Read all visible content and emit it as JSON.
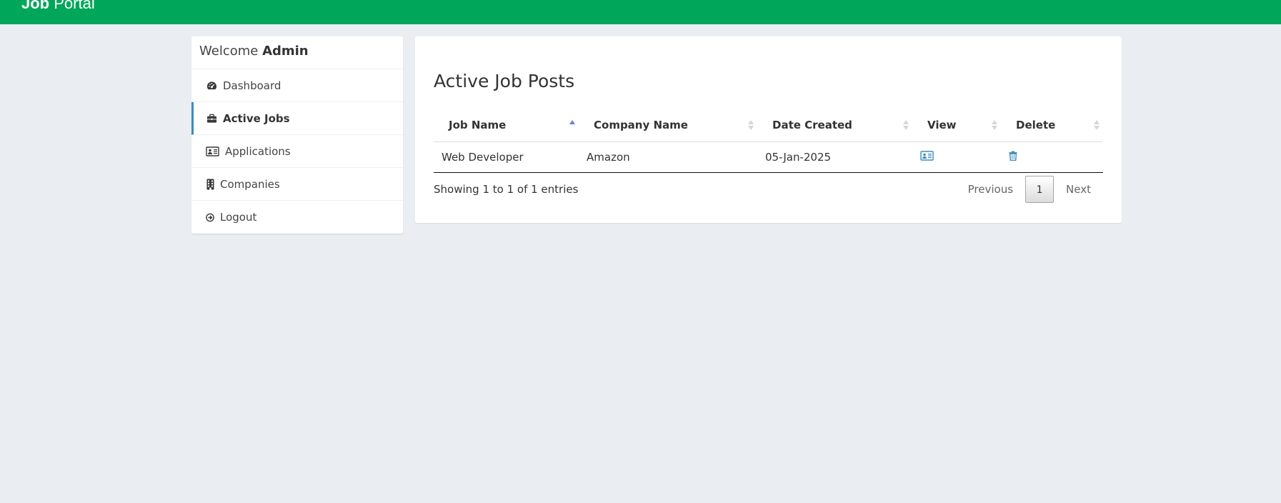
{
  "header": {
    "brand_bold": "Job",
    "brand_rest": " Portal",
    "bg_color": "#00a65a"
  },
  "sidebar": {
    "welcome_prefix": "Welcome ",
    "welcome_user": "Admin",
    "items": [
      {
        "label": "Dashboard",
        "icon": "dashboard-icon",
        "active": false
      },
      {
        "label": "Active Jobs",
        "icon": "briefcase-icon",
        "active": true
      },
      {
        "label": "Applications",
        "icon": "id-card-icon",
        "active": false
      },
      {
        "label": "Companies",
        "icon": "building-icon",
        "active": false
      },
      {
        "label": "Logout",
        "icon": "logout-icon",
        "active": false
      }
    ],
    "active_color": "#3c8dbc"
  },
  "main": {
    "title": "Active Job Posts",
    "table": {
      "columns": [
        "Job Name",
        "Company Name",
        "Date Created",
        "View",
        "Delete"
      ],
      "sorted_column": "Job Name",
      "sort_direction": "ascending",
      "rows": [
        {
          "job_name": "Web Developer",
          "company_name": "Amazon",
          "date_created": "05-Jan-2025",
          "view_icon": "id-card-icon",
          "delete_icon": "trash-icon"
        }
      ]
    },
    "info_text": "Showing 1 to 1 of 1 entries",
    "pagination": {
      "previous_label": "Previous",
      "current_page": "1",
      "next_label": "Next"
    }
  }
}
